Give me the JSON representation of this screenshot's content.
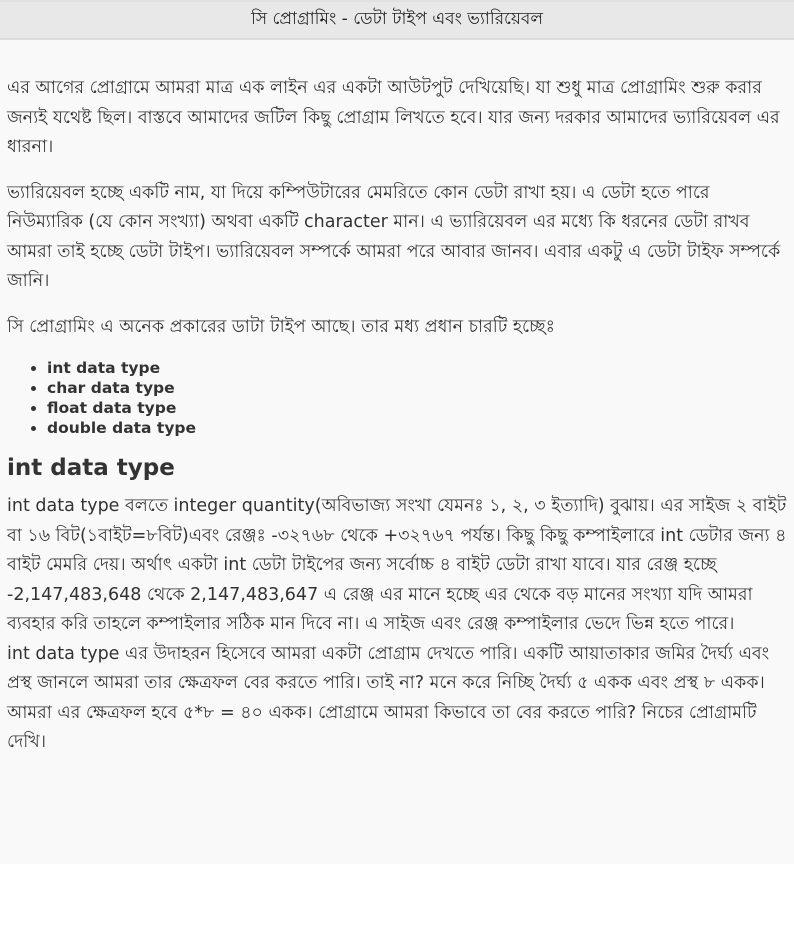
{
  "header": {
    "title": "সি প্রোগ্রামিং - ডেটা টাইপ এবং ভ্যারিয়েবল"
  },
  "article": {
    "intro_paragraph": "এর আগের প্রোগ্রামে আমরা মাত্র এক লাইন এর একটা আউটপুট দেখিয়েছি। যা শুধু মাত্র প্রোগ্রামিং শুরু করার জন্যই যথেষ্ট ছিল। বাস্তবে আমাদের জটিল কিছু প্রোগ্রাম লিখতে হবে। যার জন্য দরকার আমাদের ভ্যারিয়েবল এর ধারনা।",
    "variable_paragraph": "ভ্যারিয়েবল হচ্ছে একটি নাম, যা দিয়ে কম্পিউটারের মেমরিতে কোন ডেটা রাখা হয়। এ ডেটা হতে পারে নিউম্যারিক (যে কোন সংখ্যা) অথবা একটি character মান। এ ভ্যারিয়েবল এর মধ্যে কি ধরনের ডেটা রাখব আমরা তাই হচ্ছে ডেটা টাইপ। ভ্যারিয়েবল সম্পর্কে আমরা পরে আবার জানব। এবার একটু এ ডেটা টাইফ সম্পর্কে জানি।",
    "types_intro": "সি প্রোগ্রামিং এ অনেক প্রকারের ডাটা টাইপ আছে। তার মধ্য প্রধান চারটি হচ্ছেঃ",
    "data_types": [
      "int data type",
      "char data type",
      "float data type",
      "double data type"
    ],
    "section_heading": "int data type",
    "int_paragraph_1": "int data type বলতে integer quantity(অবিভাজ্য সংখা যেমনঃ ১, ২, ৩ ইত্যাদি) বুঝায়। এর সাইজ ২ বাইট বা ১৬ বিট(১বাইট=৮বিট)এবং রেঞ্জঃ -৩২৭৬৮ থেকে +৩২৭৬৭ পর্যন্ত। কিছু কিছু কম্পাইলারে int ডেটার জন্য ৪ বাইট মেমরি দেয়। অর্থাৎ একটা int ডেটা টাইপের জন্য সর্বোচ্চ ৪ বাইট ডেটা রাখা যাবে। যার রেঞ্জ হচ্ছে -2,147,483,648 থেকে 2,147,483,647 এ রেঞ্জ এর মানে হচ্ছে এর থেকে বড় মানের সংখ্যা যদি আমরা ব্যবহার করি তাহলে কম্পাইলার সঠিক মান দিবে না। এ সাইজ এবং রেঞ্জ কম্পাইলার ভেদে ভিন্ন হতে পারে।",
    "int_paragraph_2": "int data type এর উদাহরন হিসেবে আমরা একটা প্রোগ্রাম দেখতে পারি। একটি আয়াতাকার জমির দৈর্ঘ্য এবং প্রস্থ জানলে আমরা তার ক্ষেত্রফল বের করতে পারি। তাই না? মনে করে নিচ্ছি দৈর্ঘ্য ৫ একক এবং প্রস্থ ৮ একক। আমরা এর ক্ষেত্রফল হবে ৫*৮ = ৪০ একক। প্রোগ্রামে আমরা কিভাবে তা বের করতে পারি? নিচের প্রোগ্রামটি দেখি।"
  }
}
